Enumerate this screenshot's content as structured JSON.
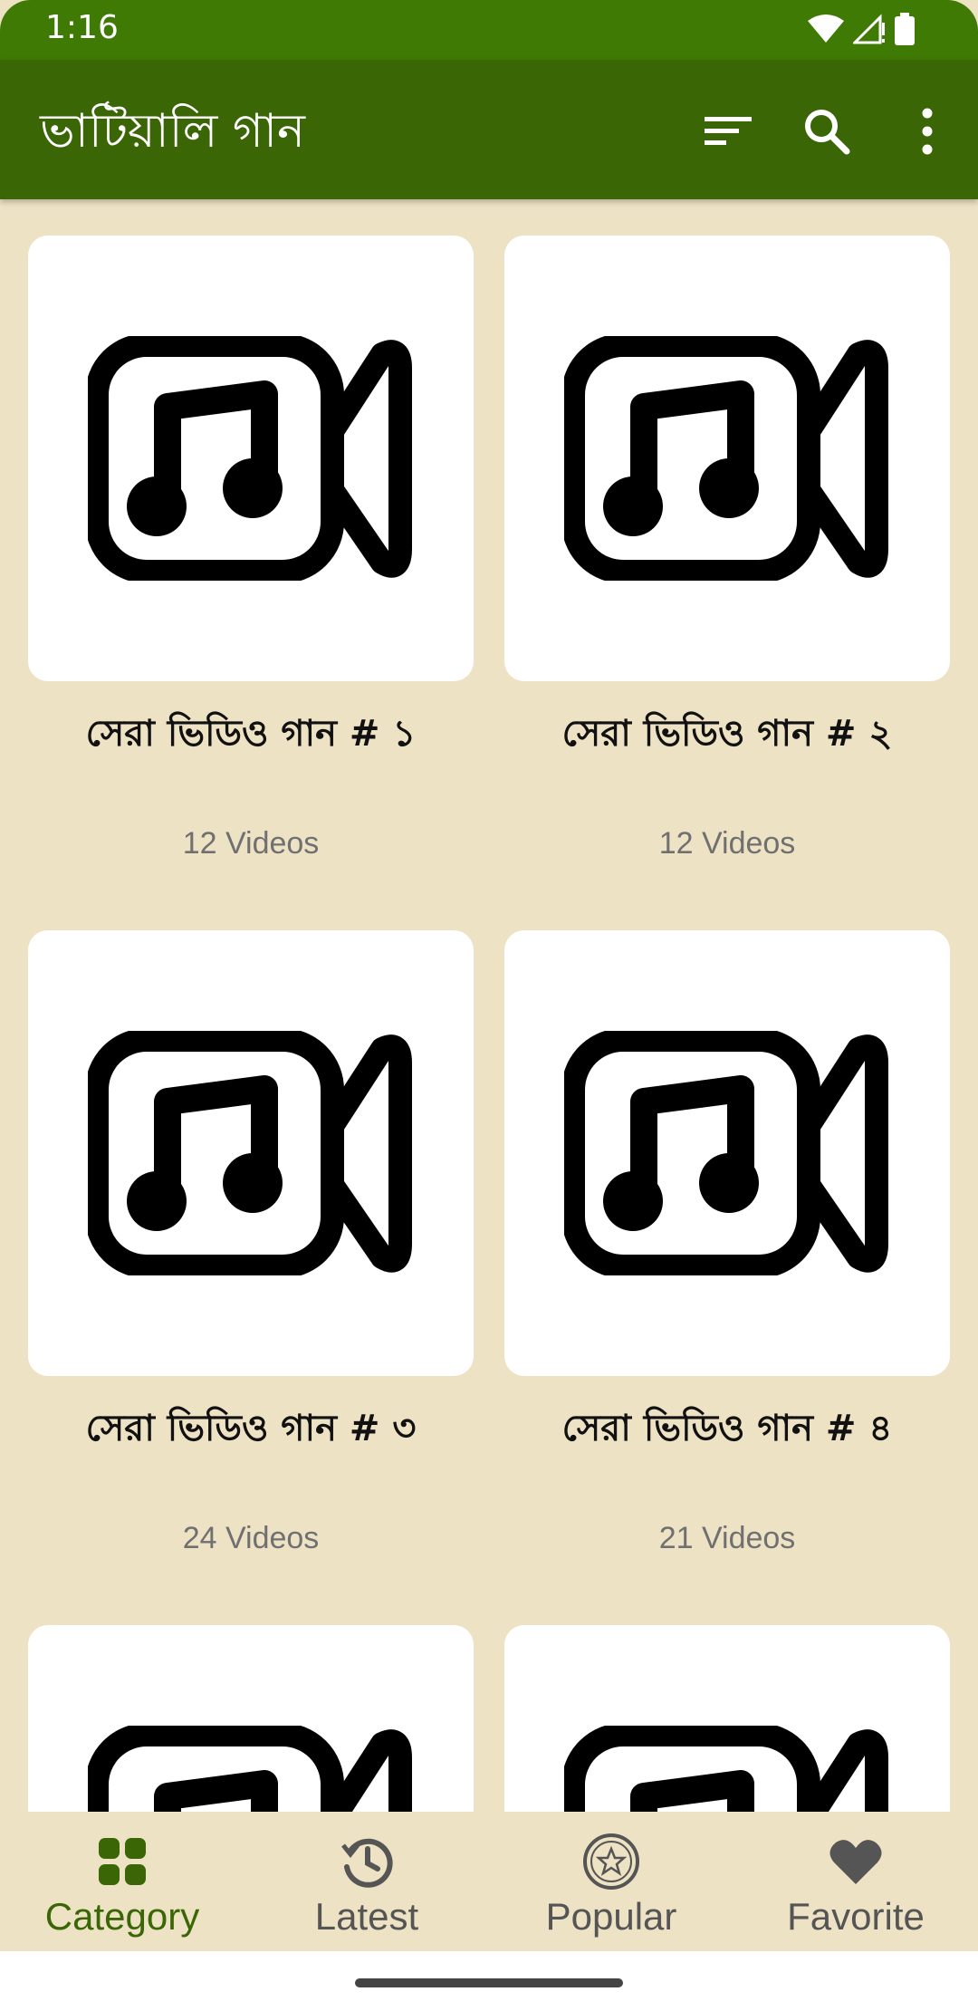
{
  "status_bar": {
    "time": "1:16"
  },
  "app_bar": {
    "title": "ভাটিয়ালি গান"
  },
  "categories": [
    {
      "title": "সেরা ভিডিও গান # ১",
      "count": "12 Videos"
    },
    {
      "title": "সেরা ভিডিও গান # ২",
      "count": "12 Videos"
    },
    {
      "title": "সেরা ভিডিও গান # ৩",
      "count": "24 Videos"
    },
    {
      "title": "সেরা ভিডিও গান # ৪",
      "count": "21 Videos"
    },
    {
      "title": "",
      "count": ""
    },
    {
      "title": "",
      "count": ""
    }
  ],
  "bottom_nav": {
    "items": [
      {
        "label": "Category",
        "icon": "grid-icon",
        "active": true
      },
      {
        "label": "Latest",
        "icon": "history-icon",
        "active": false
      },
      {
        "label": "Popular",
        "icon": "star-badge-icon",
        "active": false
      },
      {
        "label": "Favorite",
        "icon": "heart-icon",
        "active": false
      }
    ]
  },
  "colors": {
    "status_bar": "#3f7a05",
    "app_bar": "#3a6606",
    "background": "#ede2c4",
    "active_tab": "#3a6606",
    "inactive_tab": "#555555"
  }
}
